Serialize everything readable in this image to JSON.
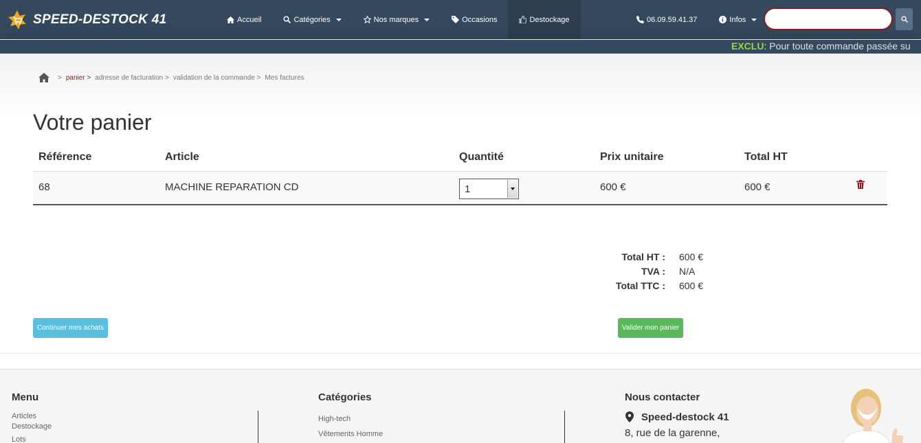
{
  "brand": {
    "name": "SPEED-DESTOCK 41",
    "logo_icon": "cart-star-logo-icon"
  },
  "nav": {
    "items": [
      {
        "label": "Accueil",
        "icon": "home-icon"
      },
      {
        "label": "Catégories",
        "icon": "search-icon"
      },
      {
        "label": "Nos marques",
        "icon": "star-icon"
      },
      {
        "label": "Occasions",
        "icon": "tag-icon"
      },
      {
        "label": "Destockage",
        "icon": "thumbs-up-icon"
      }
    ],
    "phone": "06.09.59.41.37",
    "infos": "Infos"
  },
  "search": {
    "placeholder": "",
    "value": ""
  },
  "ticker": {
    "highlight": "EXCLU",
    "text": ": Pour toute commande passée su"
  },
  "breadcrumb": [
    "panier >",
    "adresse de facturation >",
    "validation de la commande >",
    "Mes factures"
  ],
  "page_title": "Votre panier",
  "table": {
    "headers": [
      "Référence",
      "Article",
      "Quantité",
      "Prix unitaire",
      "Total HT"
    ],
    "rows": [
      {
        "reference": "68",
        "article": "MACHINE REPARATION CD",
        "quantity": "1",
        "unit_price": "600 €",
        "total": "600 €"
      }
    ]
  },
  "totals": {
    "total_ht_label": "Total HT :",
    "total_ht": "600 €",
    "tva_label": "TVA :",
    "tva": "N/A",
    "total_ttc_label": "Total TTC :",
    "total_ttc": "600 €"
  },
  "buttons": {
    "continue": "Continuer mes achats",
    "validate": "Valider mon panier"
  },
  "footer": {
    "menu_title": "Menu",
    "menu_items": [
      "Articles",
      "Destockage",
      "Lots"
    ],
    "categories_title": "Catégories",
    "categories_items": [
      "High-tech",
      "Vêtements Homme"
    ],
    "contact_title": "Nous contacter",
    "contact_name": "Speed-destock 41",
    "contact_address": "8, rue de la garenne,"
  },
  "colors": {
    "navbar": "#34495e",
    "accent_red": "#8b1a1a",
    "info": "#5bc0de",
    "success": "#5cb85c",
    "ticker_highlight": "#9bd93a"
  }
}
